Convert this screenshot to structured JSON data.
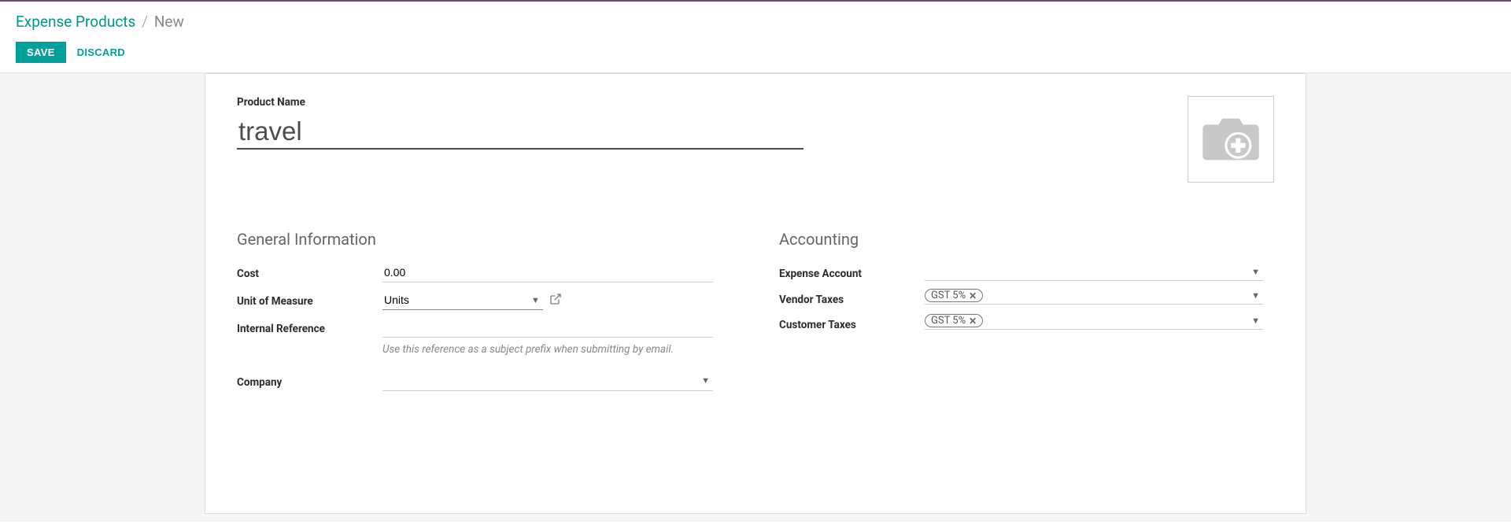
{
  "breadcrumb": {
    "root": "Expense Products",
    "sep": "/",
    "current": "New"
  },
  "actions": {
    "save": "SAVE",
    "discard": "DISCARD"
  },
  "product": {
    "name_label": "Product Name",
    "name_value": "travel"
  },
  "sections": {
    "general": "General Information",
    "accounting": "Accounting"
  },
  "general": {
    "cost_label": "Cost",
    "cost_value": "0.00",
    "uom_label": "Unit of Measure",
    "uom_value": "Units",
    "internal_ref_label": "Internal Reference",
    "internal_ref_value": "",
    "internal_ref_help": "Use this reference as a subject prefix when submitting by email.",
    "company_label": "Company",
    "company_value": ""
  },
  "accounting": {
    "expense_account_label": "Expense Account",
    "expense_account_value": "",
    "vendor_taxes_label": "Vendor Taxes",
    "vendor_taxes_tag": "GST 5%",
    "customer_taxes_label": "Customer Taxes",
    "customer_taxes_tag": "GST 5%"
  }
}
